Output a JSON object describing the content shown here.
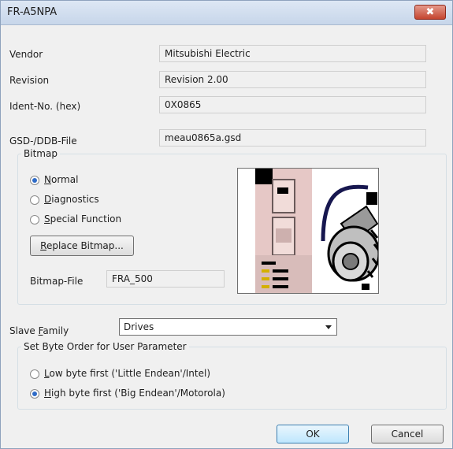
{
  "window": {
    "title": "FR-A5NPA",
    "close_glyph": "✖"
  },
  "fields": {
    "vendor": {
      "label": "Vendor",
      "value": "Mitsubishi Electric"
    },
    "revision": {
      "label": "Revision",
      "value": "Revision 2.00"
    },
    "ident": {
      "label": "Ident-No. (hex)",
      "value": "0X0865"
    },
    "gsd": {
      "label": "GSD-/DDB-File",
      "value": "meau0865a.gsd"
    }
  },
  "bitmap": {
    "legend": "Bitmap",
    "options": [
      {
        "access_key": "N",
        "rest": "ormal",
        "selected": true
      },
      {
        "access_key": "D",
        "rest": "iagnostics",
        "selected": false
      },
      {
        "access_key": "S",
        "rest": "pecial Function",
        "selected": false
      }
    ],
    "replace_key": "R",
    "replace_rest": "eplace Bitmap...",
    "file_label": "Bitmap-File",
    "file_value": "FRA_500",
    "image_icon": "inverter-and-motor-bitmap"
  },
  "slave_family": {
    "label_pre": "Slave ",
    "label_key": "F",
    "label_post": "amily",
    "value": "Drives"
  },
  "byte_order": {
    "legend": "Set Byte Order for User Parameter",
    "options": [
      {
        "access_key": "L",
        "rest": "ow byte first ('Little Endean'/Intel)",
        "selected": false
      },
      {
        "access_key": "H",
        "rest": "igh byte first ('Big Endean'/Motorola)",
        "selected": true
      }
    ]
  },
  "buttons": {
    "ok": "OK",
    "cancel": "Cancel"
  }
}
